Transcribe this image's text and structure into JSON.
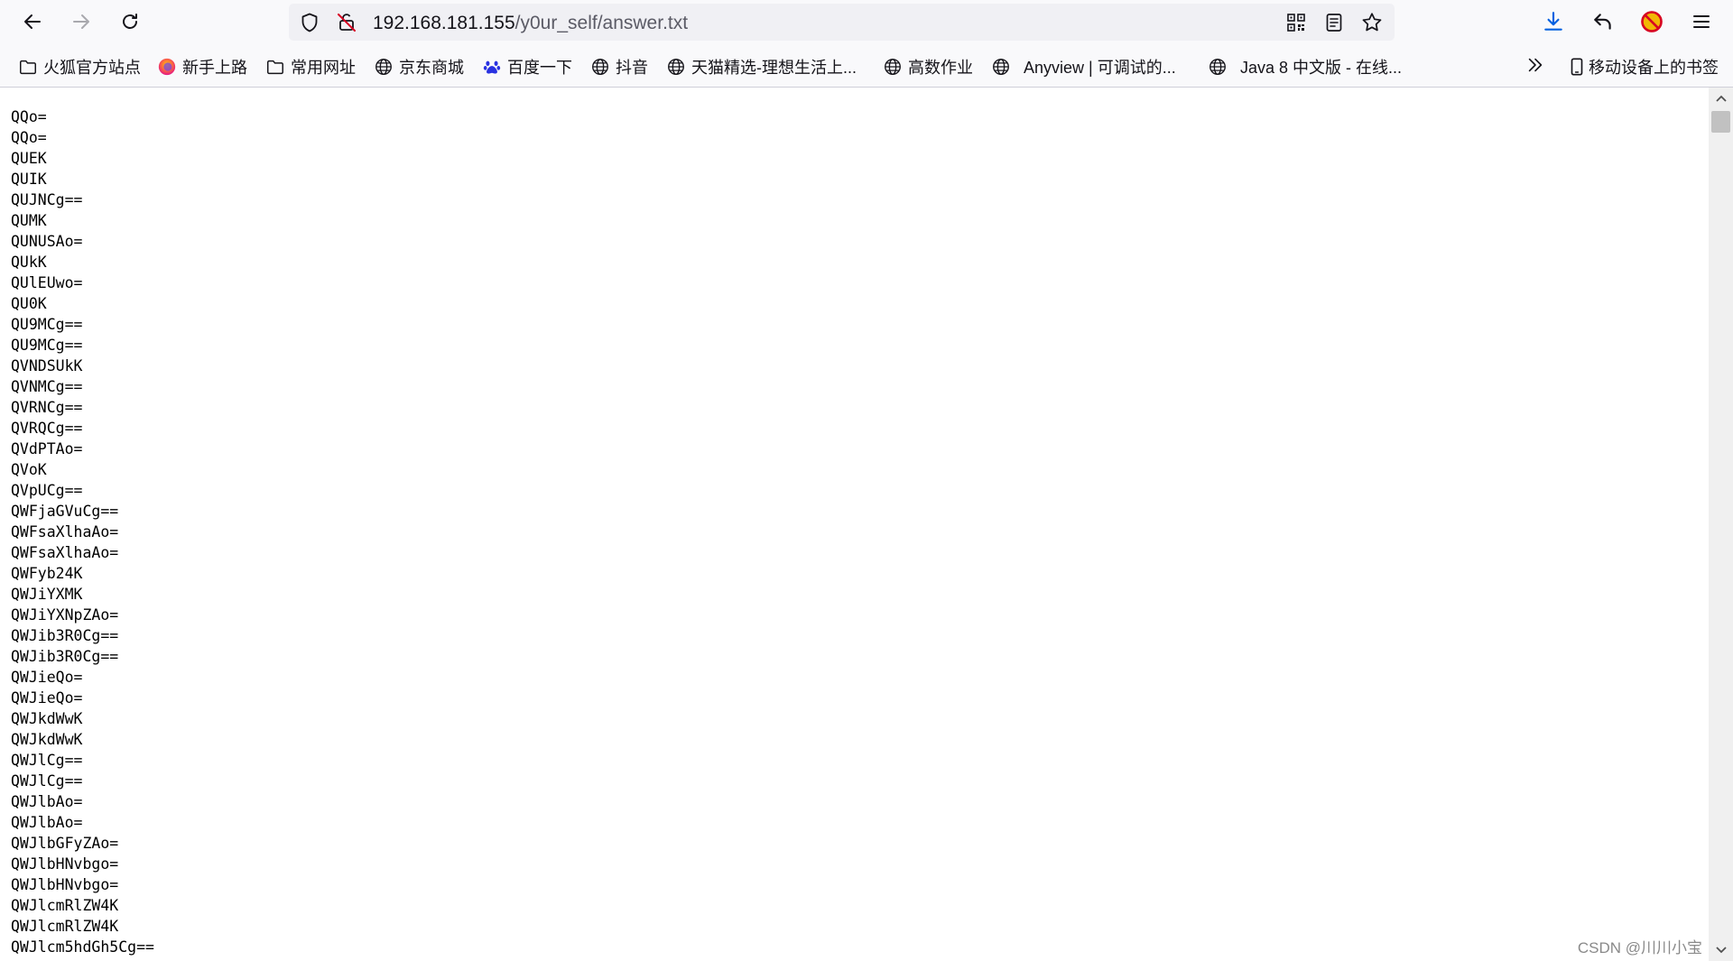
{
  "colors": {
    "toolbar_bg": "#f9f9fb",
    "urlbar_bg": "#f0f0f4",
    "download_accent": "#0061e0",
    "blocked_red": "#d70022"
  },
  "urlbar": {
    "host": "192.168.181.155",
    "path": "/y0ur_self/answer.txt"
  },
  "bookmarks": [
    {
      "label": "火狐官方站点",
      "icon": "folder-icon"
    },
    {
      "label": "新手上路",
      "icon": "firefox-icon"
    },
    {
      "label": "常用网址",
      "icon": "folder-icon"
    },
    {
      "label": "京东商城",
      "icon": "globe-icon"
    },
    {
      "label": "百度一下",
      "icon": "baidu-paw-icon"
    },
    {
      "label": "抖音",
      "icon": "globe-icon"
    },
    {
      "label": "天猫精选-理想生活上...",
      "icon": "globe-icon"
    },
    {
      "label": "高数作业",
      "icon": "globe-icon"
    },
    {
      "label": "Anyview | 可调试的...",
      "icon": "globe-icon"
    },
    {
      "label": "Java 8 中文版 - 在线...",
      "icon": "globe-icon"
    }
  ],
  "mobile_bookmarks": "移动设备上的书签",
  "file_lines": [
    "QQo=",
    "QQo=",
    "QUEK",
    "QUIK",
    "QUJNCg==",
    "QUMK",
    "QUNUSAo=",
    "QUkK",
    "QUlEUwo=",
    "QU0K",
    "QU9MCg==",
    "QU9MCg==",
    "QVNDSUkK",
    "QVNMCg==",
    "QVRNCg==",
    "QVRQCg==",
    "QVdPTAo=",
    "QVoK",
    "QVpUCg==",
    "QWFjaGVuCg==",
    "QWFsaXlhaAo=",
    "QWFsaXlhaAo=",
    "QWFyb24K",
    "QWJiYXMK",
    "QWJiYXNpZAo=",
    "QWJib3R0Cg==",
    "QWJib3R0Cg==",
    "QWJieQo=",
    "QWJieQo=",
    "QWJkdWwK",
    "QWJkdWwK",
    "QWJlCg==",
    "QWJlCg==",
    "QWJlbAo=",
    "QWJlbAo=",
    "QWJlbGFyZAo=",
    "QWJlbHNvbgo=",
    "QWJlbHNvbgo=",
    "QWJlcmRlZW4K",
    "QWJlcmRlZW4K",
    "QWJlcm5hdGh5Cg=="
  ],
  "watermark": "CSDN @川川小宝"
}
